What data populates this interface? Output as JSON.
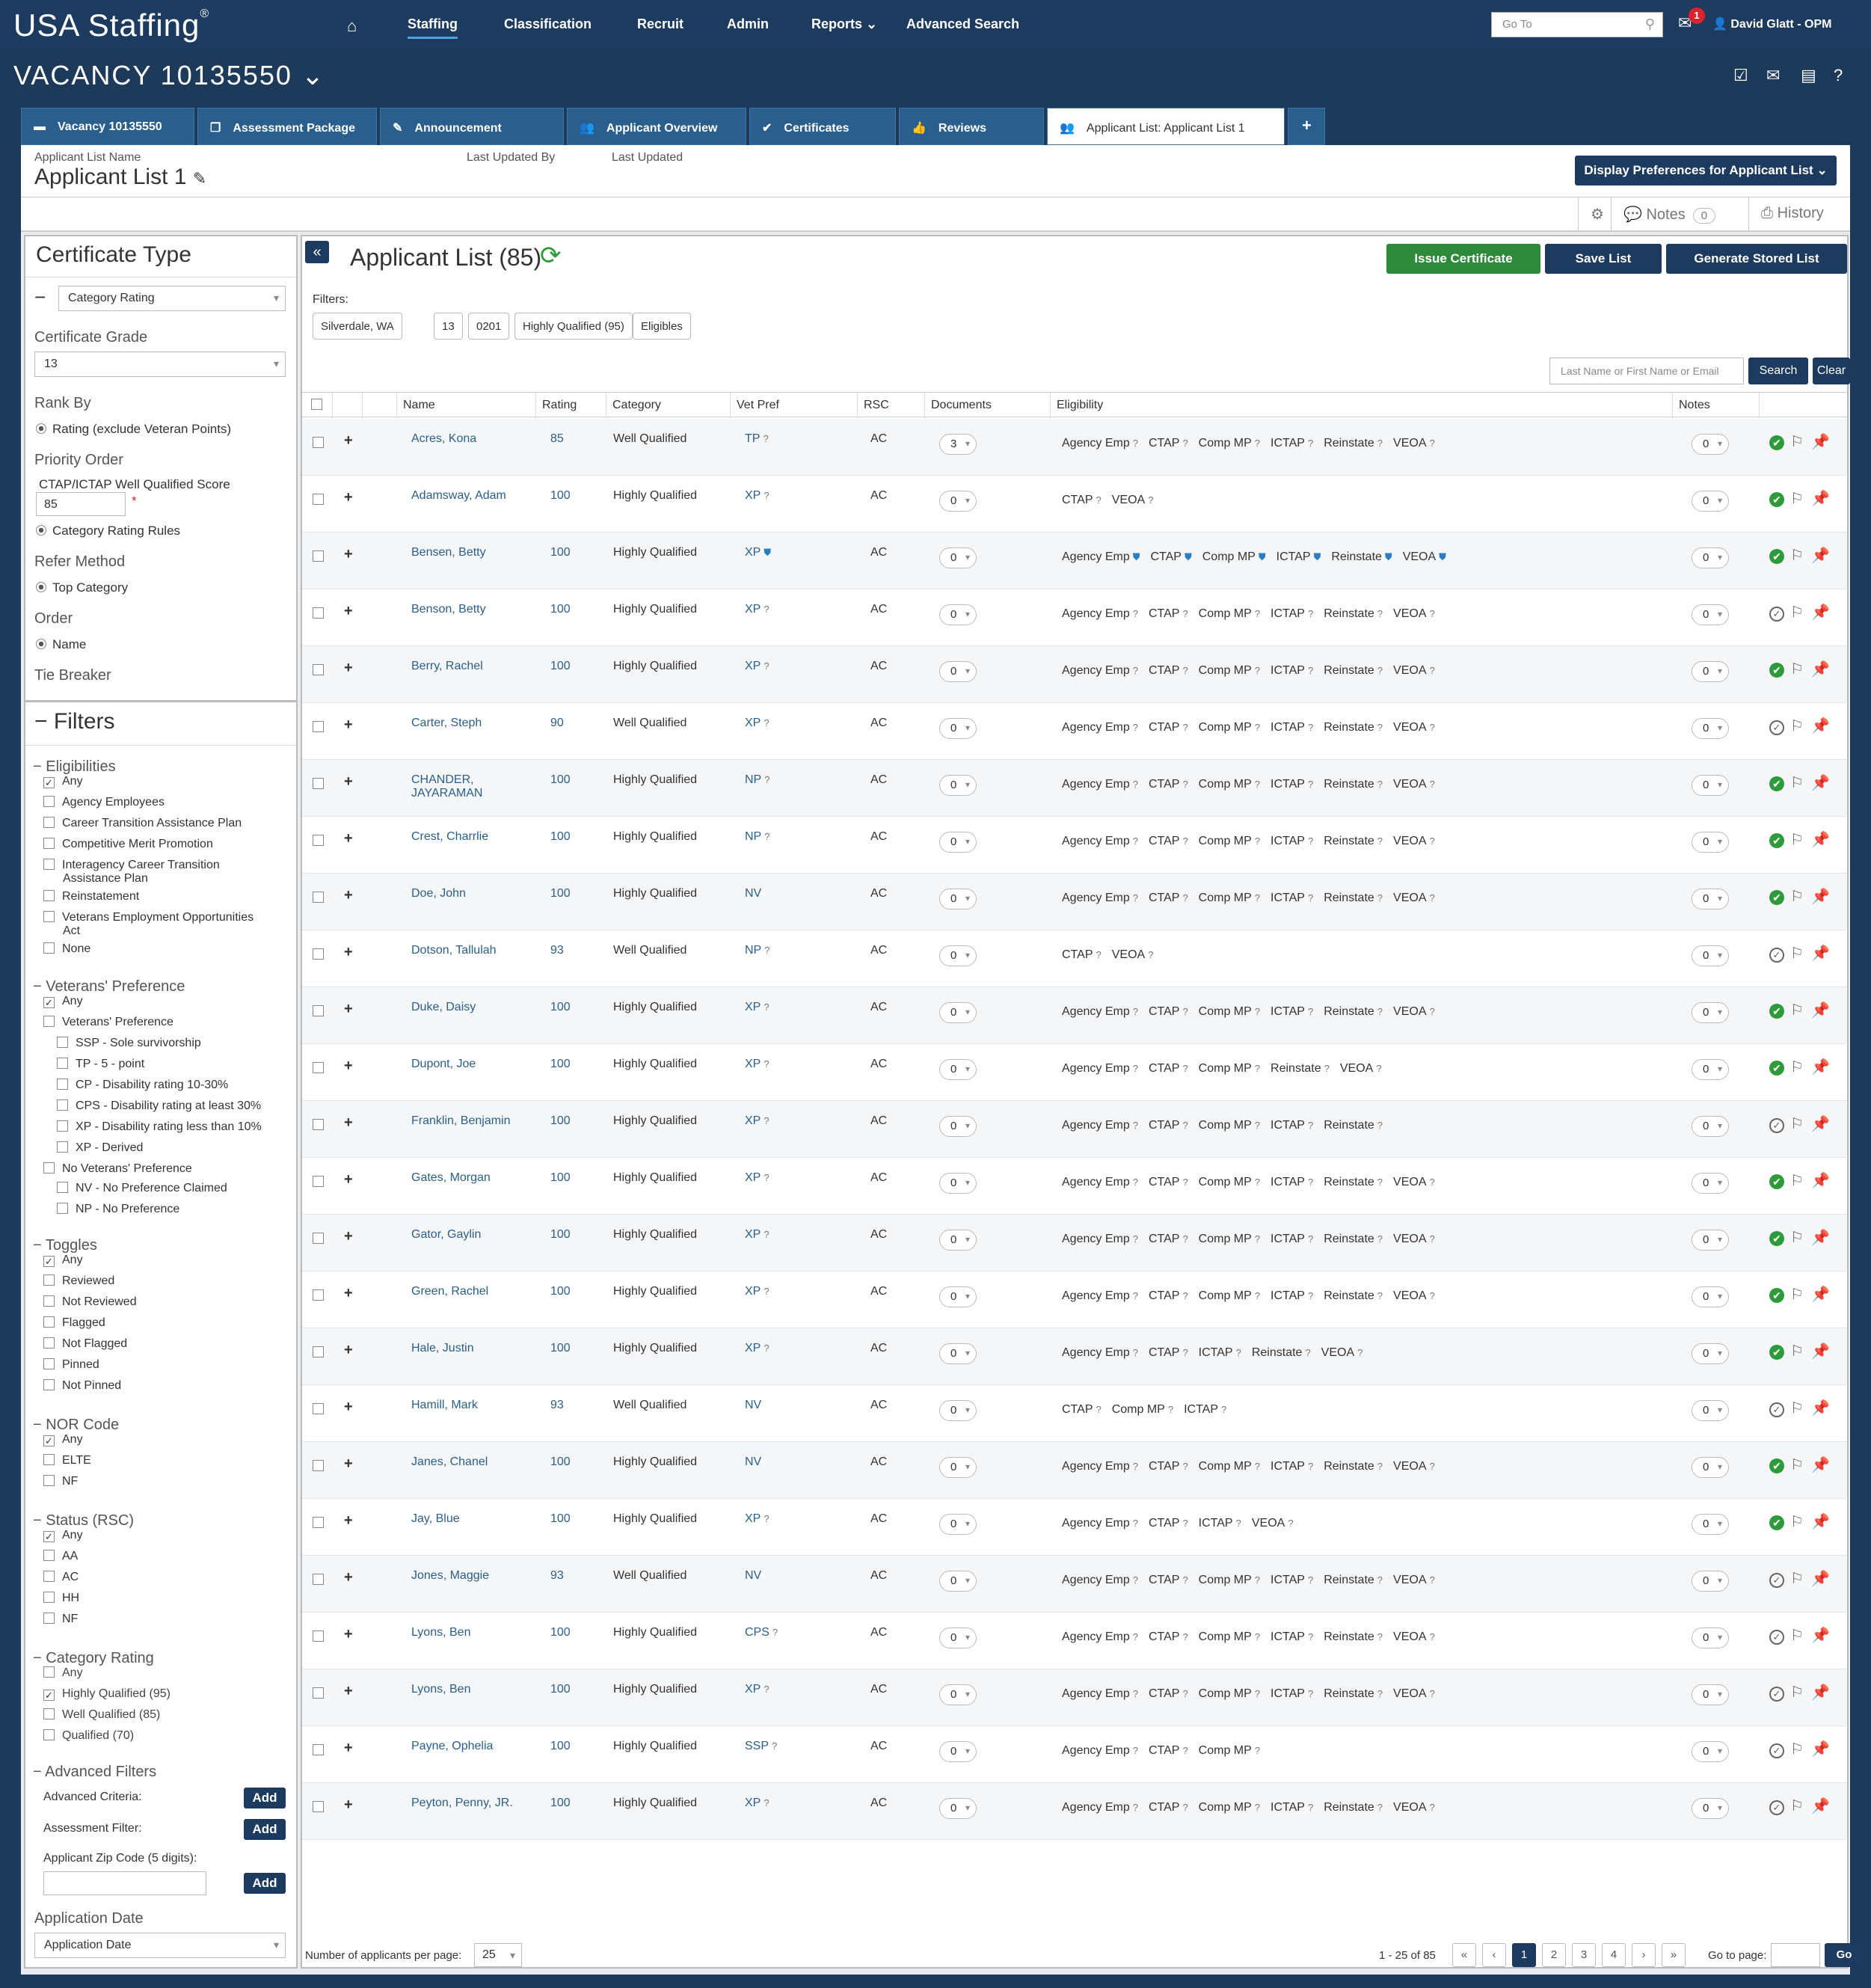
{
  "app": {
    "logo": "USA Staffing",
    "logo_mark": "®"
  },
  "nav": {
    "items": [
      "Staffing",
      "Classification",
      "Recruit",
      "Admin",
      "Reports",
      "Advanced Search"
    ],
    "reports_caret": "⌄",
    "goto_placeholder": "Go To",
    "mail_badge": "1",
    "user": "David Glatt - OPM"
  },
  "vacancy": {
    "title": "VACANCY 10135550 ⌄"
  },
  "tabs": [
    {
      "label": "Vacancy 10135550",
      "icon": "folder-icon"
    },
    {
      "label": "Assessment Package",
      "icon": "documents-icon"
    },
    {
      "label": "Announcement",
      "icon": "megaphone-icon"
    },
    {
      "label": "Applicant Overview",
      "icon": "users-icon"
    },
    {
      "label": "Certificates",
      "icon": "check-circle-icon"
    },
    {
      "label": "Reviews",
      "icon": "thumbs-up-icon"
    },
    {
      "label": "Applicant List: Applicant List 1",
      "icon": "users-icon"
    },
    {
      "label": "+",
      "icon": "plus-icon"
    }
  ],
  "list_header": {
    "name_label": "Applicant List Name",
    "name": "Applicant List 1",
    "last_updated_by_label": "Last Updated By",
    "last_updated_label": "Last Updated",
    "display_prefs": "Display Preferences for Applicant List ⌄"
  },
  "tools": {
    "notes": "Notes",
    "notes_count": "0",
    "history": "History"
  },
  "left": {
    "cert_type_title": "Certificate Type",
    "cert_type_value": "Category Rating",
    "cert_grade_label": "Certificate Grade",
    "cert_grade_value": "13",
    "rank_by_label": "Rank By",
    "rank_by_value": "Rating (exclude Veteran Points)",
    "priority_label": "Priority Order",
    "ctap_label": "CTAP/ICTAP Well Qualified Score",
    "ctap_value": "85",
    "ctap_required": "*",
    "priority_value": "Category Rating Rules",
    "refer_label": "Refer Method",
    "refer_value": "Top Category",
    "order_label": "Order",
    "order_value": "Name",
    "tie_label": "Tie Breaker",
    "filters_title": "Filters",
    "eligibilities": {
      "title": "Eligibilities",
      "items": [
        "Any",
        "Agency Employees",
        "Career Transition Assistance Plan",
        "Competitive Merit Promotion",
        "Interagency Career Transition",
        "Assistance Plan",
        "Reinstatement",
        "Veterans Employment Opportunities",
        "Act",
        "None"
      ]
    },
    "vets": {
      "title": "Veterans' Preference",
      "items": [
        "Any",
        "Veterans' Preference",
        "SSP - Sole survivorship",
        "TP - 5 - point",
        "CP - Disability rating 10-30%",
        "CPS - Disability rating at least 30%",
        "XP - Disability rating less than 10%",
        "XP - Derived",
        "No Veterans' Preference",
        "NV - No Preference Claimed",
        "NP - No Preference"
      ]
    },
    "toggles": {
      "title": "Toggles",
      "items": [
        "Any",
        "Reviewed",
        "Not Reviewed",
        "Flagged",
        "Not Flagged",
        "Pinned",
        "Not Pinned"
      ]
    },
    "nor": {
      "title": "NOR Code",
      "items": [
        "Any",
        "ELTE",
        "NF"
      ]
    },
    "status": {
      "title": "Status (RSC)",
      "items": [
        "Any",
        "AA",
        "AC",
        "HH",
        "NF"
      ]
    },
    "category": {
      "title": "Category Rating",
      "items": [
        "Any",
        "Highly Qualified (95)",
        "Well Qualified (85)",
        "Qualified (70)"
      ]
    },
    "advanced": {
      "title": "Advanced Filters",
      "criteria": "Advanced Criteria:",
      "assessment": "Assessment Filter:",
      "zip": "Applicant Zip Code (5 digits):",
      "add": "Add"
    },
    "app_date_label": "Application Date",
    "app_date_value": "Application Date"
  },
  "main": {
    "title": "Applicant List (85)",
    "issue": "Issue Certificate",
    "save": "Save List",
    "generate": "Generate Stored List",
    "filters_label": "Filters:",
    "chips": [
      "Silverdale, WA",
      "13",
      "0201",
      "Highly Qualified (95)",
      "Eligibles"
    ],
    "search_placeholder": "Last Name or First Name or Email",
    "search": "Search",
    "clear": "Clear",
    "columns": [
      "Name",
      "Rating",
      "Category",
      "Vet Pref",
      "RSC",
      "Documents",
      "Eligibility",
      "Notes"
    ],
    "rows": [
      {
        "name": "Acres, Kona",
        "rating": "85",
        "category": "Well Qualified",
        "vet": "TP",
        "rsc": "AC",
        "docs": "3",
        "elig": [
          "Agency Emp",
          "CTAP",
          "Comp MP",
          "ICTAP",
          "Reinstate",
          "VEOA"
        ],
        "notes": "0",
        "status": "green",
        "pin": "off"
      },
      {
        "name": "Adamsway, Adam",
        "rating": "100",
        "category": "Highly Qualified",
        "vet": "XP",
        "rsc": "AC",
        "docs": "0",
        "elig": [
          "CTAP",
          "VEOA"
        ],
        "notes": "0",
        "status": "green",
        "pin": "off"
      },
      {
        "name": "Bensen, Betty",
        "rating": "100",
        "category": "Highly Qualified",
        "vet": "XP",
        "rsc": "AC",
        "docs": "0",
        "elig": [
          "Agency Emp",
          "CTAP",
          "Comp MP",
          "ICTAP",
          "Reinstate",
          "VEOA"
        ],
        "notes": "0",
        "status": "green",
        "pin": "off",
        "shield": true
      },
      {
        "name": "Benson, Betty",
        "rating": "100",
        "category": "Highly Qualified",
        "vet": "XP",
        "rsc": "AC",
        "docs": "0",
        "elig": [
          "Agency Emp",
          "CTAP",
          "Comp MP",
          "ICTAP",
          "Reinstate",
          "VEOA"
        ],
        "notes": "0",
        "status": "grey",
        "pin": "off"
      },
      {
        "name": "Berry, Rachel",
        "rating": "100",
        "category": "Highly Qualified",
        "vet": "XP",
        "rsc": "AC",
        "docs": "0",
        "elig": [
          "Agency Emp",
          "CTAP",
          "Comp MP",
          "ICTAP",
          "Reinstate",
          "VEOA"
        ],
        "notes": "0",
        "status": "green",
        "pin": "off"
      },
      {
        "name": "Carter, Steph",
        "rating": "90",
        "category": "Well Qualified",
        "vet": "XP",
        "rsc": "AC",
        "docs": "0",
        "elig": [
          "Agency Emp",
          "CTAP",
          "Comp MP",
          "ICTAP",
          "Reinstate",
          "VEOA"
        ],
        "notes": "0",
        "status": "grey",
        "pin": "off"
      },
      {
        "name": "CHANDER, JAYARAMAN",
        "rating": "100",
        "category": "Highly Qualified",
        "vet": "NP",
        "rsc": "AC",
        "docs": "0",
        "elig": [
          "Agency Emp",
          "CTAP",
          "Comp MP",
          "ICTAP",
          "Reinstate",
          "VEOA"
        ],
        "notes": "0",
        "status": "green",
        "pin": "off"
      },
      {
        "name": "Crest, Charrlie",
        "rating": "100",
        "category": "Highly Qualified",
        "vet": "NP",
        "rsc": "AC",
        "docs": "0",
        "elig": [
          "Agency Emp",
          "CTAP",
          "Comp MP",
          "ICTAP",
          "Reinstate",
          "VEOA"
        ],
        "notes": "0",
        "status": "green",
        "pin": "on"
      },
      {
        "name": "Doe, John",
        "rating": "100",
        "category": "Highly Qualified",
        "vet": "NV",
        "rsc": "AC",
        "docs": "0",
        "elig": [
          "Agency Emp",
          "CTAP",
          "Comp MP",
          "ICTAP",
          "Reinstate",
          "VEOA"
        ],
        "notes": "0",
        "status": "green",
        "pin": "on"
      },
      {
        "name": "Dotson, Tallulah",
        "rating": "93",
        "category": "Well Qualified",
        "vet": "NP",
        "rsc": "AC",
        "docs": "0",
        "elig": [
          "CTAP",
          "VEOA"
        ],
        "notes": "0",
        "status": "grey",
        "pin": "off"
      },
      {
        "name": "Duke, Daisy",
        "rating": "100",
        "category": "Highly Qualified",
        "vet": "XP",
        "rsc": "AC",
        "docs": "0",
        "elig": [
          "Agency Emp",
          "CTAP",
          "Comp MP",
          "ICTAP",
          "Reinstate",
          "VEOA"
        ],
        "notes": "0",
        "status": "green",
        "pin": "off"
      },
      {
        "name": "Dupont, Joe",
        "rating": "100",
        "category": "Highly Qualified",
        "vet": "XP",
        "rsc": "AC",
        "docs": "0",
        "elig": [
          "Agency Emp",
          "CTAP",
          "Comp MP",
          "Reinstate",
          "VEOA"
        ],
        "notes": "0",
        "status": "green",
        "pin": "off"
      },
      {
        "name": "Franklin, Benjamin",
        "rating": "100",
        "category": "Highly Qualified",
        "vet": "XP",
        "rsc": "AC",
        "docs": "0",
        "elig": [
          "Agency Emp",
          "CTAP",
          "Comp MP",
          "ICTAP",
          "Reinstate"
        ],
        "notes": "0",
        "status": "grey",
        "pin": "off"
      },
      {
        "name": "Gates, Morgan",
        "rating": "100",
        "category": "Highly Qualified",
        "vet": "XP",
        "rsc": "AC",
        "docs": "0",
        "elig": [
          "Agency Emp",
          "CTAP",
          "Comp MP",
          "ICTAP",
          "Reinstate",
          "VEOA"
        ],
        "notes": "0",
        "status": "green",
        "pin": "off"
      },
      {
        "name": "Gator, Gaylin",
        "rating": "100",
        "category": "Highly Qualified",
        "vet": "XP",
        "rsc": "AC",
        "docs": "0",
        "elig": [
          "Agency Emp",
          "CTAP",
          "Comp MP",
          "ICTAP",
          "Reinstate",
          "VEOA"
        ],
        "notes": "0",
        "status": "green",
        "pin": "off"
      },
      {
        "name": "Green, Rachel",
        "rating": "100",
        "category": "Highly Qualified",
        "vet": "XP",
        "rsc": "AC",
        "docs": "0",
        "elig": [
          "Agency Emp",
          "CTAP",
          "Comp MP",
          "ICTAP",
          "Reinstate",
          "VEOA"
        ],
        "notes": "0",
        "status": "green",
        "pin": "off"
      },
      {
        "name": "Hale, Justin",
        "rating": "100",
        "category": "Highly Qualified",
        "vet": "XP",
        "rsc": "AC",
        "docs": "0",
        "elig": [
          "Agency Emp",
          "CTAP",
          "ICTAP",
          "Reinstate",
          "VEOA"
        ],
        "notes": "0",
        "status": "green",
        "pin": "off"
      },
      {
        "name": "Hamill, Mark",
        "rating": "93",
        "category": "Well Qualified",
        "vet": "NV",
        "rsc": "AC",
        "docs": "0",
        "elig": [
          "CTAP",
          "Comp MP",
          "ICTAP"
        ],
        "notes": "0",
        "status": "grey",
        "pin": "off"
      },
      {
        "name": "Janes, Chanel",
        "rating": "100",
        "category": "Highly Qualified",
        "vet": "NV",
        "rsc": "AC",
        "docs": "0",
        "elig": [
          "Agency Emp",
          "CTAP",
          "Comp MP",
          "ICTAP",
          "Reinstate",
          "VEOA"
        ],
        "notes": "0",
        "status": "green",
        "pin": "off"
      },
      {
        "name": "Jay, Blue",
        "rating": "100",
        "category": "Highly Qualified",
        "vet": "XP",
        "rsc": "AC",
        "docs": "0",
        "elig": [
          "Agency Emp",
          "CTAP",
          "ICTAP",
          "VEOA"
        ],
        "notes": "0",
        "status": "green",
        "pin": "off"
      },
      {
        "name": "Jones, Maggie",
        "rating": "93",
        "category": "Well Qualified",
        "vet": "NV",
        "rsc": "AC",
        "docs": "0",
        "elig": [
          "Agency Emp",
          "CTAP",
          "Comp MP",
          "ICTAP",
          "Reinstate",
          "VEOA"
        ],
        "notes": "0",
        "status": "grey",
        "pin": "off"
      },
      {
        "name": "Lyons, Ben",
        "rating": "100",
        "category": "Highly Qualified",
        "vet": "CPS",
        "rsc": "AC",
        "docs": "0",
        "elig": [
          "Agency Emp",
          "CTAP",
          "Comp MP",
          "ICTAP",
          "Reinstate",
          "VEOA"
        ],
        "notes": "0",
        "status": "grey",
        "pin": "off"
      },
      {
        "name": "Lyons, Ben",
        "rating": "100",
        "category": "Highly Qualified",
        "vet": "XP",
        "rsc": "AC",
        "docs": "0",
        "elig": [
          "Agency Emp",
          "CTAP",
          "Comp MP",
          "ICTAP",
          "Reinstate",
          "VEOA"
        ],
        "notes": "0",
        "status": "grey",
        "pin": "off"
      },
      {
        "name": "Payne, Ophelia",
        "rating": "100",
        "category": "Highly Qualified",
        "vet": "SSP",
        "rsc": "AC",
        "docs": "0",
        "elig": [
          "Agency Emp",
          "CTAP",
          "Comp MP"
        ],
        "notes": "0",
        "status": "grey",
        "pin": "off"
      },
      {
        "name": "Peyton, Penny, JR.",
        "rating": "100",
        "category": "Highly Qualified",
        "vet": "XP",
        "rsc": "AC",
        "docs": "0",
        "elig": [
          "Agency Emp",
          "CTAP",
          "Comp MP",
          "ICTAP",
          "Reinstate",
          "VEOA"
        ],
        "notes": "0",
        "status": "grey",
        "pin": "off"
      }
    ],
    "footer": {
      "per_page_label": "Number of applicants per page:",
      "per_page": "25",
      "range": "1 - 25 of 85",
      "pages": [
        "«",
        "‹",
        "1",
        "2",
        "3",
        "4",
        "›",
        "»"
      ],
      "goto_label": "Go to page:",
      "go": "Go"
    }
  },
  "colors": {
    "navy": "#1c3b5e",
    "green": "#2e9b3a",
    "link": "#2a5e8c",
    "pin_orange": "#e57c15"
  }
}
